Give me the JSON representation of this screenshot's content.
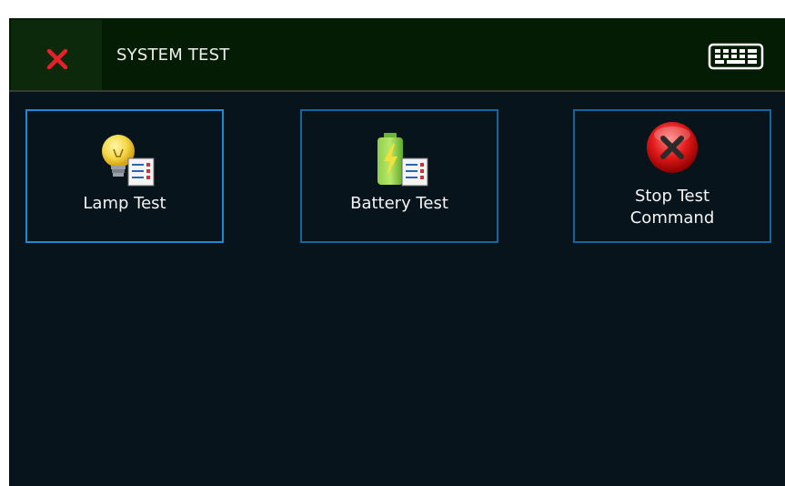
{
  "header": {
    "title": "SYSTEM TEST"
  },
  "tiles": [
    {
      "label": "Lamp Test",
      "icon": "lamp-test-icon"
    },
    {
      "label": "Battery Test",
      "icon": "battery-test-icon"
    },
    {
      "label": "Stop Test\nCommand",
      "icon": "stop-icon"
    }
  ],
  "colors": {
    "header_bg": "#041c03",
    "screen_bg": "#07141c",
    "tile_border": "#1565a0",
    "close_red": "#e8202a"
  }
}
